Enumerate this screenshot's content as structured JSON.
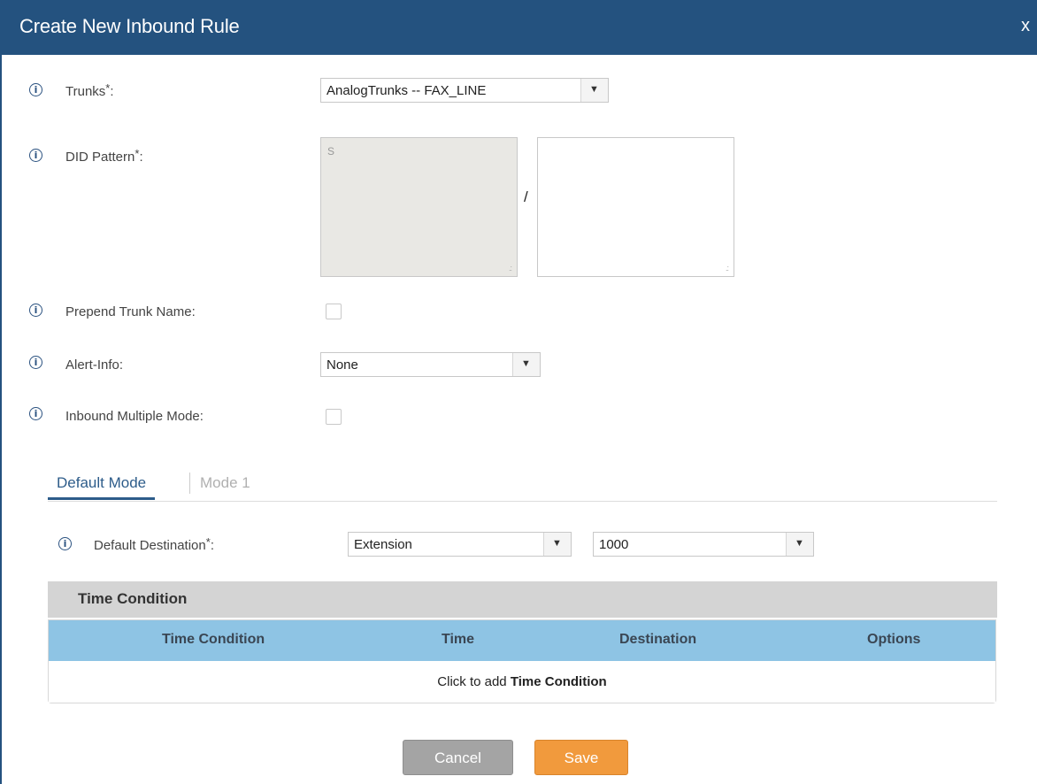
{
  "dialog": {
    "title": "Create New Inbound Rule",
    "close_label": "x"
  },
  "fields": {
    "trunks": {
      "label": "Trunks",
      "required_mark": "*",
      "colon": ":",
      "value": "AnalogTrunks -- FAX_LINE"
    },
    "did_pattern": {
      "label": "DID Pattern",
      "required_mark": "*",
      "colon": ":",
      "value": "S",
      "separator": "/",
      "second_value": ""
    },
    "prepend_trunk_name": {
      "label": "Prepend Trunk Name:",
      "checked": false
    },
    "alert_info": {
      "label": "Alert-Info:",
      "value": "None"
    },
    "inbound_multiple_mode": {
      "label": "Inbound Multiple Mode:",
      "checked": false
    }
  },
  "tabs": [
    {
      "label": "Default Mode",
      "active": true
    },
    {
      "label": "Mode 1",
      "active": false
    }
  ],
  "default_destination": {
    "label": "Default Destination",
    "required_mark": "*",
    "colon": ":",
    "type_value": "Extension",
    "target_value": "1000"
  },
  "time_condition": {
    "section_title": "Time Condition",
    "columns": [
      "Time Condition",
      "Time",
      "Destination",
      "Options"
    ],
    "empty_text_prefix": "Click to add ",
    "empty_text_bold": "Time Condition"
  },
  "buttons": {
    "cancel": "Cancel",
    "save": "Save"
  },
  "colors": {
    "titlebar": "#24527f",
    "table_header": "#8ec4e4",
    "save": "#f19a3d",
    "cancel": "#a4a4a4"
  },
  "icons": {
    "info": "info-circle-icon",
    "dropdown": "triangle-down-icon",
    "resize": "resize-grip-icon"
  }
}
